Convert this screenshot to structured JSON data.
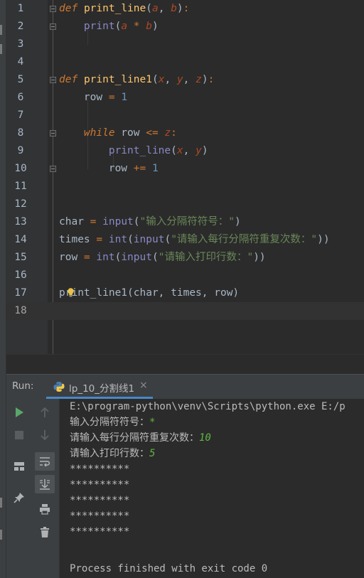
{
  "editor": {
    "lines": [
      {
        "n": "1",
        "tokens": [
          {
            "c": "kw",
            "t": "def"
          },
          {
            "c": "plain",
            "t": " "
          },
          {
            "c": "fn",
            "t": "print_line"
          },
          {
            "c": "plain",
            "t": "("
          },
          {
            "c": "param",
            "t": "a"
          },
          {
            "c": "plain",
            "t": ", "
          },
          {
            "c": "param",
            "t": "b"
          },
          {
            "c": "plain",
            "t": ")"
          },
          {
            "c": "op",
            "t": ":"
          }
        ]
      },
      {
        "n": "2",
        "tokens": [
          {
            "c": "plain",
            "t": "    "
          },
          {
            "c": "bi",
            "t": "print"
          },
          {
            "c": "plain",
            "t": "("
          },
          {
            "c": "param",
            "t": "a"
          },
          {
            "c": "plain",
            "t": " "
          },
          {
            "c": "op",
            "t": "*"
          },
          {
            "c": "plain",
            "t": " "
          },
          {
            "c": "param",
            "t": "b"
          },
          {
            "c": "plain",
            "t": ")"
          }
        ]
      },
      {
        "n": "3",
        "tokens": []
      },
      {
        "n": "4",
        "tokens": []
      },
      {
        "n": "5",
        "tokens": [
          {
            "c": "kw",
            "t": "def"
          },
          {
            "c": "plain",
            "t": " "
          },
          {
            "c": "fn",
            "t": "print_line1"
          },
          {
            "c": "plain",
            "t": "("
          },
          {
            "c": "param",
            "t": "x"
          },
          {
            "c": "plain",
            "t": ", "
          },
          {
            "c": "param",
            "t": "y"
          },
          {
            "c": "plain",
            "t": ", "
          },
          {
            "c": "param",
            "t": "z"
          },
          {
            "c": "plain",
            "t": ")"
          },
          {
            "c": "op",
            "t": ":"
          }
        ]
      },
      {
        "n": "6",
        "tokens": [
          {
            "c": "plain",
            "t": "    row "
          },
          {
            "c": "op",
            "t": "="
          },
          {
            "c": "plain",
            "t": " "
          },
          {
            "c": "num",
            "t": "1"
          }
        ]
      },
      {
        "n": "7",
        "tokens": []
      },
      {
        "n": "8",
        "tokens": [
          {
            "c": "plain",
            "t": "    "
          },
          {
            "c": "kw",
            "t": "while"
          },
          {
            "c": "plain",
            "t": " row "
          },
          {
            "c": "op",
            "t": "<="
          },
          {
            "c": "plain",
            "t": " "
          },
          {
            "c": "param",
            "t": "z"
          },
          {
            "c": "op",
            "t": ":"
          }
        ]
      },
      {
        "n": "9",
        "tokens": [
          {
            "c": "plain",
            "t": "        "
          },
          {
            "c": "bi",
            "t": "print_line"
          },
          {
            "c": "plain",
            "t": "("
          },
          {
            "c": "param",
            "t": "x"
          },
          {
            "c": "plain",
            "t": ", "
          },
          {
            "c": "param",
            "t": "y"
          },
          {
            "c": "plain",
            "t": ")"
          }
        ]
      },
      {
        "n": "10",
        "tokens": [
          {
            "c": "plain",
            "t": "        row "
          },
          {
            "c": "op",
            "t": "+="
          },
          {
            "c": "plain",
            "t": " "
          },
          {
            "c": "num",
            "t": "1"
          }
        ]
      },
      {
        "n": "11",
        "tokens": []
      },
      {
        "n": "12",
        "tokens": []
      },
      {
        "n": "13",
        "tokens": [
          {
            "c": "plain",
            "t": "char "
          },
          {
            "c": "op",
            "t": "="
          },
          {
            "c": "plain",
            "t": " "
          },
          {
            "c": "bi",
            "t": "input"
          },
          {
            "c": "plain",
            "t": "("
          },
          {
            "c": "str",
            "t": "\"输入分隔符符号：\""
          },
          {
            "c": "plain",
            "t": ")"
          }
        ]
      },
      {
        "n": "14",
        "tokens": [
          {
            "c": "plain",
            "t": "times "
          },
          {
            "c": "op",
            "t": "="
          },
          {
            "c": "plain",
            "t": " "
          },
          {
            "c": "bi",
            "t": "int"
          },
          {
            "c": "plain",
            "t": "("
          },
          {
            "c": "bi",
            "t": "input"
          },
          {
            "c": "plain",
            "t": "("
          },
          {
            "c": "str",
            "t": "\"请输入每行分隔符重复次数：\""
          },
          {
            "c": "plain",
            "t": "))"
          }
        ]
      },
      {
        "n": "15",
        "tokens": [
          {
            "c": "plain",
            "t": "row "
          },
          {
            "c": "op",
            "t": "="
          },
          {
            "c": "plain",
            "t": " "
          },
          {
            "c": "bi",
            "t": "int"
          },
          {
            "c": "plain",
            "t": "("
          },
          {
            "c": "bi",
            "t": "input"
          },
          {
            "c": "plain",
            "t": "("
          },
          {
            "c": "str",
            "t": "\"请输入打印行数：\""
          },
          {
            "c": "plain",
            "t": "))"
          }
        ]
      },
      {
        "n": "16",
        "tokens": []
      },
      {
        "n": "17",
        "tokens": [
          {
            "c": "plain",
            "t": "print_line1(char, times, row)"
          }
        ]
      },
      {
        "n": "18",
        "tokens": []
      }
    ],
    "fold_lines": [
      "1",
      "2",
      "5",
      "8",
      "10"
    ],
    "current_line": "18"
  },
  "run_panel": {
    "label": "Run:",
    "tab_name": "lp_10_分割线1",
    "tab_close": "×",
    "console_lines": [
      [
        {
          "c": "out",
          "t": "E:\\program-python\\venv\\Scripts\\python.exe E:/p"
        }
      ],
      [
        {
          "c": "out",
          "t": "输入分隔符符号："
        },
        {
          "c": "in",
          "t": "*"
        }
      ],
      [
        {
          "c": "out",
          "t": "请输入每行分隔符重复次数："
        },
        {
          "c": "in",
          "t": "10"
        }
      ],
      [
        {
          "c": "out",
          "t": "请输入打印行数："
        },
        {
          "c": "in",
          "t": "5"
        }
      ],
      [
        {
          "c": "out",
          "t": "**********"
        }
      ],
      [
        {
          "c": "out",
          "t": "**********"
        }
      ],
      [
        {
          "c": "out",
          "t": "**********"
        }
      ],
      [
        {
          "c": "out",
          "t": "**********"
        }
      ],
      [
        {
          "c": "out",
          "t": "**********"
        }
      ],
      [
        {
          "c": "out",
          "t": ""
        }
      ],
      [
        {
          "c": "out",
          "t": "Process finished with exit code 0"
        }
      ]
    ],
    "toolbar_icons": [
      "run-icon",
      "stop-icon",
      "layout-icon",
      "pin-icon",
      "up-arrow-icon",
      "down-arrow-icon",
      "soft-wrap-icon",
      "scroll-to-end-icon",
      "print-icon",
      "trash-icon"
    ]
  },
  "colors": {
    "background": "#2b2b2b",
    "keyword": "#cc7832",
    "function": "#ffc66d",
    "parameter": "#aa4926",
    "number": "#6897bb",
    "string": "#6a8759",
    "builtin": "#8888c6",
    "user_input": "#62b543",
    "tab_underline": "#4a88c7"
  }
}
